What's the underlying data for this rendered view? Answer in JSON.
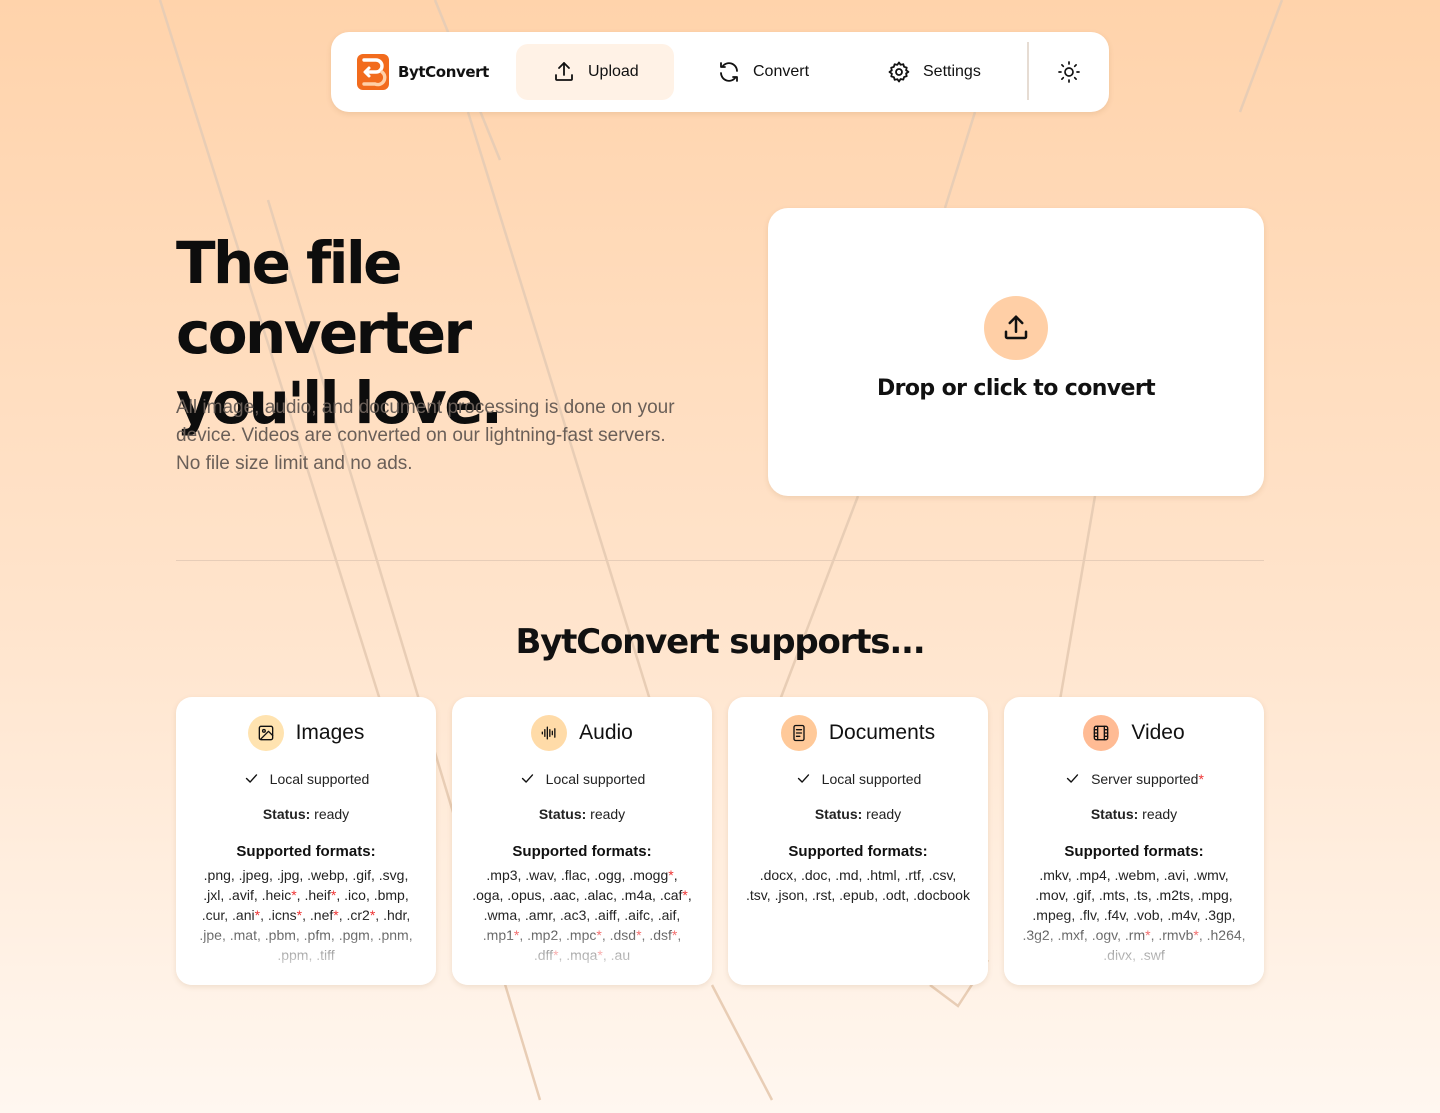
{
  "nav": {
    "brand": "BytConvert",
    "items": [
      {
        "label": "Upload",
        "icon": "upload-icon",
        "active": true
      },
      {
        "label": "Convert",
        "icon": "refresh-icon"
      },
      {
        "label": "Settings",
        "icon": "gear-icon"
      }
    ],
    "theme_icon": "sun-icon"
  },
  "hero": {
    "title_line1": "The file converter",
    "title_line2": "you'll love.",
    "description": "All image, audio, and document processing is done on your device. Videos are converted on our lightning-fast servers. No file size limit and no ads."
  },
  "dropzone": {
    "icon": "upload-icon",
    "label": "Drop or click to convert"
  },
  "supports": {
    "title": "BytConvert supports...",
    "status_label": "Status:",
    "formats_label": "Supported formats:",
    "cards": [
      {
        "title": "Images",
        "icon": "image-icon",
        "icon_bg": "#ffe3b0",
        "support": "Local supported",
        "support_star": false,
        "status": "ready",
        "formats": [
          ".png",
          ".jpeg",
          ".jpg",
          ".webp",
          ".gif",
          ".svg",
          ".jxl",
          ".avif",
          ".heic*",
          ".heif*",
          ".ico",
          ".bmp",
          ".cur",
          ".ani*",
          ".icns*",
          ".nef*",
          ".cr2*",
          ".hdr",
          ".jpe",
          ".mat",
          ".pbm",
          ".pfm",
          ".pgm",
          ".pnm",
          ".ppm",
          ".tiff"
        ]
      },
      {
        "title": "Audio",
        "icon": "waveform-icon",
        "icon_bg": "#ffdba8",
        "support": "Local supported",
        "support_star": false,
        "status": "ready",
        "formats": [
          ".mp3",
          ".wav",
          ".flac",
          ".ogg",
          ".mogg*",
          ".oga",
          ".opus",
          ".aac",
          ".alac",
          ".m4a",
          ".caf*",
          ".wma",
          ".amr",
          ".ac3",
          ".aiff",
          ".aifc",
          ".aif",
          ".mp1*",
          ".mp2",
          ".mpc*",
          ".dsd*",
          ".dsf*",
          ".dff*",
          ".mqa*",
          ".au"
        ]
      },
      {
        "title": "Documents",
        "icon": "document-icon",
        "icon_bg": "#ffc999",
        "support": "Local supported",
        "support_star": false,
        "status": "ready",
        "formats": [
          ".docx",
          ".doc",
          ".md",
          ".html",
          ".rtf",
          ".csv",
          ".tsv",
          ".json",
          ".rst",
          ".epub",
          ".odt",
          ".docbook"
        ]
      },
      {
        "title": "Video",
        "icon": "film-icon",
        "icon_bg": "#ffbb94",
        "support": "Server supported",
        "support_star": true,
        "status": "ready",
        "formats": [
          ".mkv",
          ".mp4",
          ".webm",
          ".avi",
          ".wmv",
          ".mov",
          ".gif",
          ".mts",
          ".ts",
          ".m2ts",
          ".mpg",
          ".mpeg",
          ".flv",
          ".f4v",
          ".vob",
          ".m4v",
          ".3gp",
          ".3g2",
          ".mxf",
          ".ogv",
          ".rm*",
          ".rmvb*",
          ".h264",
          ".divx",
          ".swf"
        ]
      }
    ]
  },
  "colors": {
    "accent": "#f26b1d",
    "accent_light": "#ffcfa6",
    "active_tab_bg": "#fff2e6",
    "required_star": "#e33333"
  }
}
